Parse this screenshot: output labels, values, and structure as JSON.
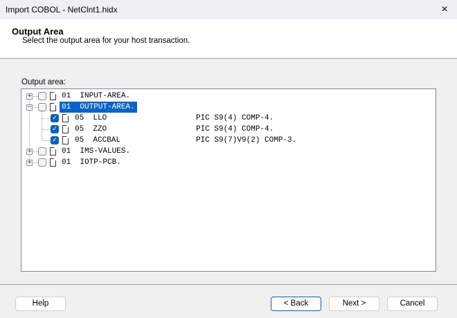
{
  "window": {
    "title": "Import COBOL - NetClnt1.hidx",
    "close_icon": "×"
  },
  "header": {
    "title": "Output Area",
    "subtitle": "Select the output area for your host transaction."
  },
  "tree_label": "Output area:",
  "tree": [
    {
      "level": "01",
      "name": "INPUT-AREA.",
      "pic": "",
      "expander": "+",
      "checked": false,
      "selected": false
    },
    {
      "level": "01",
      "name": "OUTPUT-AREA.",
      "pic": "",
      "expander": "−",
      "checked": false,
      "selected": true
    },
    {
      "level": "05",
      "name": "LLO",
      "pic": "PIC S9(4) COMP-4.",
      "checked": true
    },
    {
      "level": "05",
      "name": "ZZO",
      "pic": "PIC S9(4) COMP-4.",
      "checked": true
    },
    {
      "level": "05",
      "name": "ACCBAL",
      "pic": "PIC S9(7)V9(2) COMP-3.",
      "checked": true
    },
    {
      "level": "01",
      "name": "IMS-VALUES.",
      "pic": "",
      "expander": "+",
      "checked": false,
      "selected": false
    },
    {
      "level": "01",
      "name": "IOTP-PCB.",
      "pic": "",
      "expander": "+",
      "checked": false,
      "selected": false
    }
  ],
  "buttons": {
    "help": "Help",
    "back": "< Back",
    "next": "Next >",
    "cancel": "Cancel"
  },
  "check_mark": "✓"
}
